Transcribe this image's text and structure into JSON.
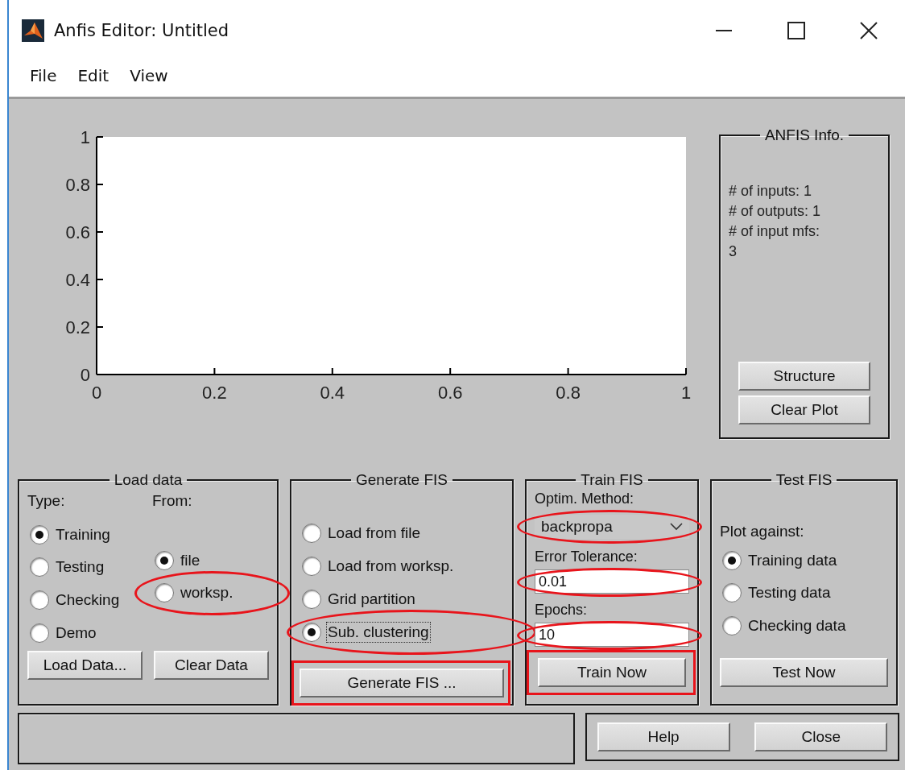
{
  "window": {
    "title": "Anfis Editor: Untitled"
  },
  "menu": [
    {
      "label": "File"
    },
    {
      "label": "Edit"
    },
    {
      "label": "View"
    }
  ],
  "plot": {
    "chart_data": {
      "type": "line",
      "xlim": [
        0,
        1
      ],
      "ylim": [
        0,
        1
      ],
      "xticks": [
        0,
        0.2,
        0.4,
        0.6,
        0.8,
        1
      ],
      "yticks": [
        0,
        0.2,
        0.4,
        0.6,
        0.8,
        1
      ]
    }
  },
  "anfis_info": {
    "title": "ANFIS Info.",
    "lines": [
      "# of inputs: 1",
      "# of outputs: 1",
      "# of input mfs:",
      "3"
    ],
    "buttons": [
      {
        "label": "Structure"
      },
      {
        "label": "Clear Plot"
      }
    ]
  },
  "load_data": {
    "title": "Load data",
    "type_label": "Type:",
    "from_label": "From:",
    "types": [
      {
        "label": "Training",
        "selected": true
      },
      {
        "label": "Testing",
        "selected": false
      },
      {
        "label": "Checking",
        "selected": false
      },
      {
        "label": "Demo",
        "selected": false
      }
    ],
    "sources": [
      {
        "label": "file",
        "selected": true,
        "highlighted": false
      },
      {
        "label": "worksp.",
        "selected": false,
        "highlighted": true
      }
    ],
    "buttons": [
      {
        "label": "Load Data..."
      },
      {
        "label": "Clear Data"
      }
    ]
  },
  "generate_fis": {
    "title": "Generate FIS",
    "options": [
      {
        "label": "Load from file",
        "selected": false,
        "focused": false,
        "highlighted": false
      },
      {
        "label": "Load from worksp.",
        "selected": false,
        "focused": false,
        "highlighted": false
      },
      {
        "label": "Grid partition",
        "selected": false,
        "focused": false,
        "highlighted": false
      },
      {
        "label": "Sub. clustering",
        "selected": true,
        "focused": true,
        "highlighted": true
      }
    ],
    "button": {
      "label": "Generate FIS ...",
      "highlighted": true
    }
  },
  "train_fis": {
    "title": "Train FIS",
    "method": {
      "label": "Optim. Method:",
      "value": "backpropa",
      "highlighted": true
    },
    "error_tolerance": {
      "label": "Error Tolerance:",
      "value": "0.01",
      "highlighted": true
    },
    "epochs": {
      "label": "Epochs:",
      "value": "10",
      "highlighted": true
    },
    "button": {
      "label": "Train Now",
      "highlighted": true
    }
  },
  "test_fis": {
    "title": "Test FIS",
    "plot_label": "Plot against:",
    "options": [
      {
        "label": "Training data",
        "selected": true
      },
      {
        "label": "Testing data",
        "selected": false
      },
      {
        "label": "Checking data",
        "selected": false
      }
    ],
    "button": {
      "label": "Test Now"
    }
  },
  "footer": {
    "buttons": [
      {
        "label": "Help"
      },
      {
        "label": "Close"
      }
    ]
  }
}
